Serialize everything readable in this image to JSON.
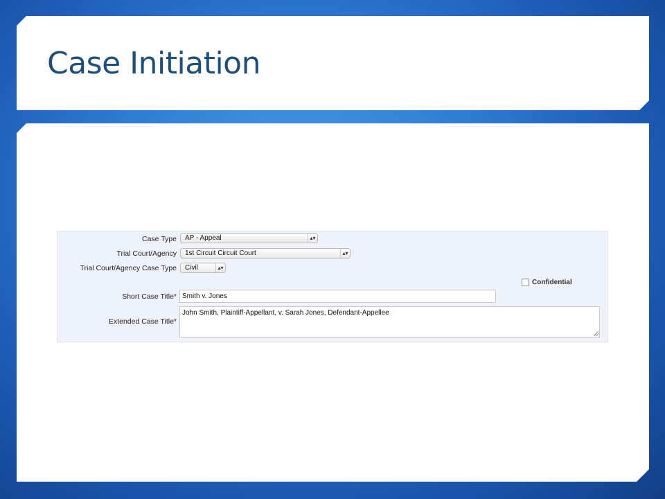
{
  "slide": {
    "title": "Case Initiation"
  },
  "form": {
    "case_type": {
      "label": "Case Type",
      "value": "AP - Appeal"
    },
    "trial_court": {
      "label": "Trial Court/Agency",
      "value": "1st Circuit Circuit Court"
    },
    "trial_case_type": {
      "label": "Trial Court/Agency Case Type",
      "value": "Civil"
    },
    "confidential": {
      "label": "Confidential",
      "checked": false
    },
    "short_title": {
      "label": "Short Case Title*",
      "value": "Smith v. Jones"
    },
    "extended_title": {
      "label": "Extended Case Title*",
      "value": "John Smith, Plaintiff-Appellant, v. Sarah Jones, Defendant-Appellee"
    },
    "select_arrow_glyph": "▲▼"
  }
}
